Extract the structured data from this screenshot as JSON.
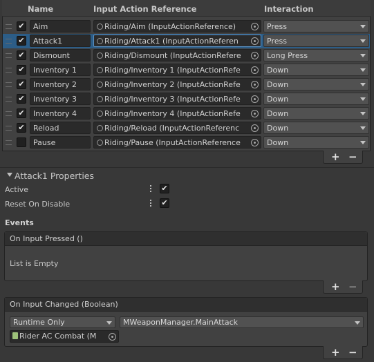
{
  "list": {
    "headers": {
      "name": "Name",
      "reference": "Input Action Reference",
      "interaction": "Interaction"
    },
    "rows": [
      {
        "name": "Aim",
        "reference": "Riding/Aim (InputActionReference)",
        "interaction": "Press",
        "active": true,
        "selected": false
      },
      {
        "name": "Attack1",
        "reference": "Riding/Attack1 (InputActionReferen",
        "interaction": "Press",
        "active": true,
        "selected": true
      },
      {
        "name": "Dismount",
        "reference": "Riding/Dismount (InputActionRefere",
        "interaction": "Long Press",
        "active": true,
        "selected": false
      },
      {
        "name": "Inventory 1",
        "reference": "Riding/Inventory 1 (InputActionRefe",
        "interaction": "Down",
        "active": true,
        "selected": false
      },
      {
        "name": "Inventory 2",
        "reference": "Riding/Inventory 2 (InputActionRefe",
        "interaction": "Down",
        "active": true,
        "selected": false
      },
      {
        "name": "Inventory 3",
        "reference": "Riding/Inventory 3 (InputActionRefe",
        "interaction": "Down",
        "active": true,
        "selected": false
      },
      {
        "name": "Inventory 4",
        "reference": "Riding/Inventory 4 (InputActionRefe",
        "interaction": "Down",
        "active": true,
        "selected": false
      },
      {
        "name": "Reload",
        "reference": "Riding/Reload (InputActionReferenc",
        "interaction": "Down",
        "active": true,
        "selected": false
      },
      {
        "name": "Pause",
        "reference": "Riding/Pause (InputActionReference",
        "interaction": "Down",
        "active": false,
        "selected": false
      }
    ],
    "add_label": "+",
    "remove_label": "−"
  },
  "properties": {
    "title": "Attack1 Properties",
    "active_label": "Active",
    "active_value": true,
    "reset_label": "Reset On Disable",
    "reset_value": true,
    "events_label": "Events"
  },
  "events": {
    "pressed": {
      "title": "On Input Pressed ()",
      "empty_text": "List is Empty"
    },
    "changed": {
      "title": "On Input Changed (Boolean)",
      "runtime_option": "Runtime Only",
      "function": "MWeaponManager.MainAttack",
      "target": "Rider AC Combat (M"
    },
    "add_label": "+",
    "remove_label": "−"
  },
  "colors": {
    "selection": "#2c5d87",
    "panel": "#414141",
    "background": "#383838"
  },
  "icons": {
    "grip": "drag-handle-icon",
    "check": "checkmark-icon",
    "ref": "input-action-icon",
    "picker": "object-picker-icon",
    "dropdown": "chevron-down-icon",
    "script": "script-icon"
  }
}
